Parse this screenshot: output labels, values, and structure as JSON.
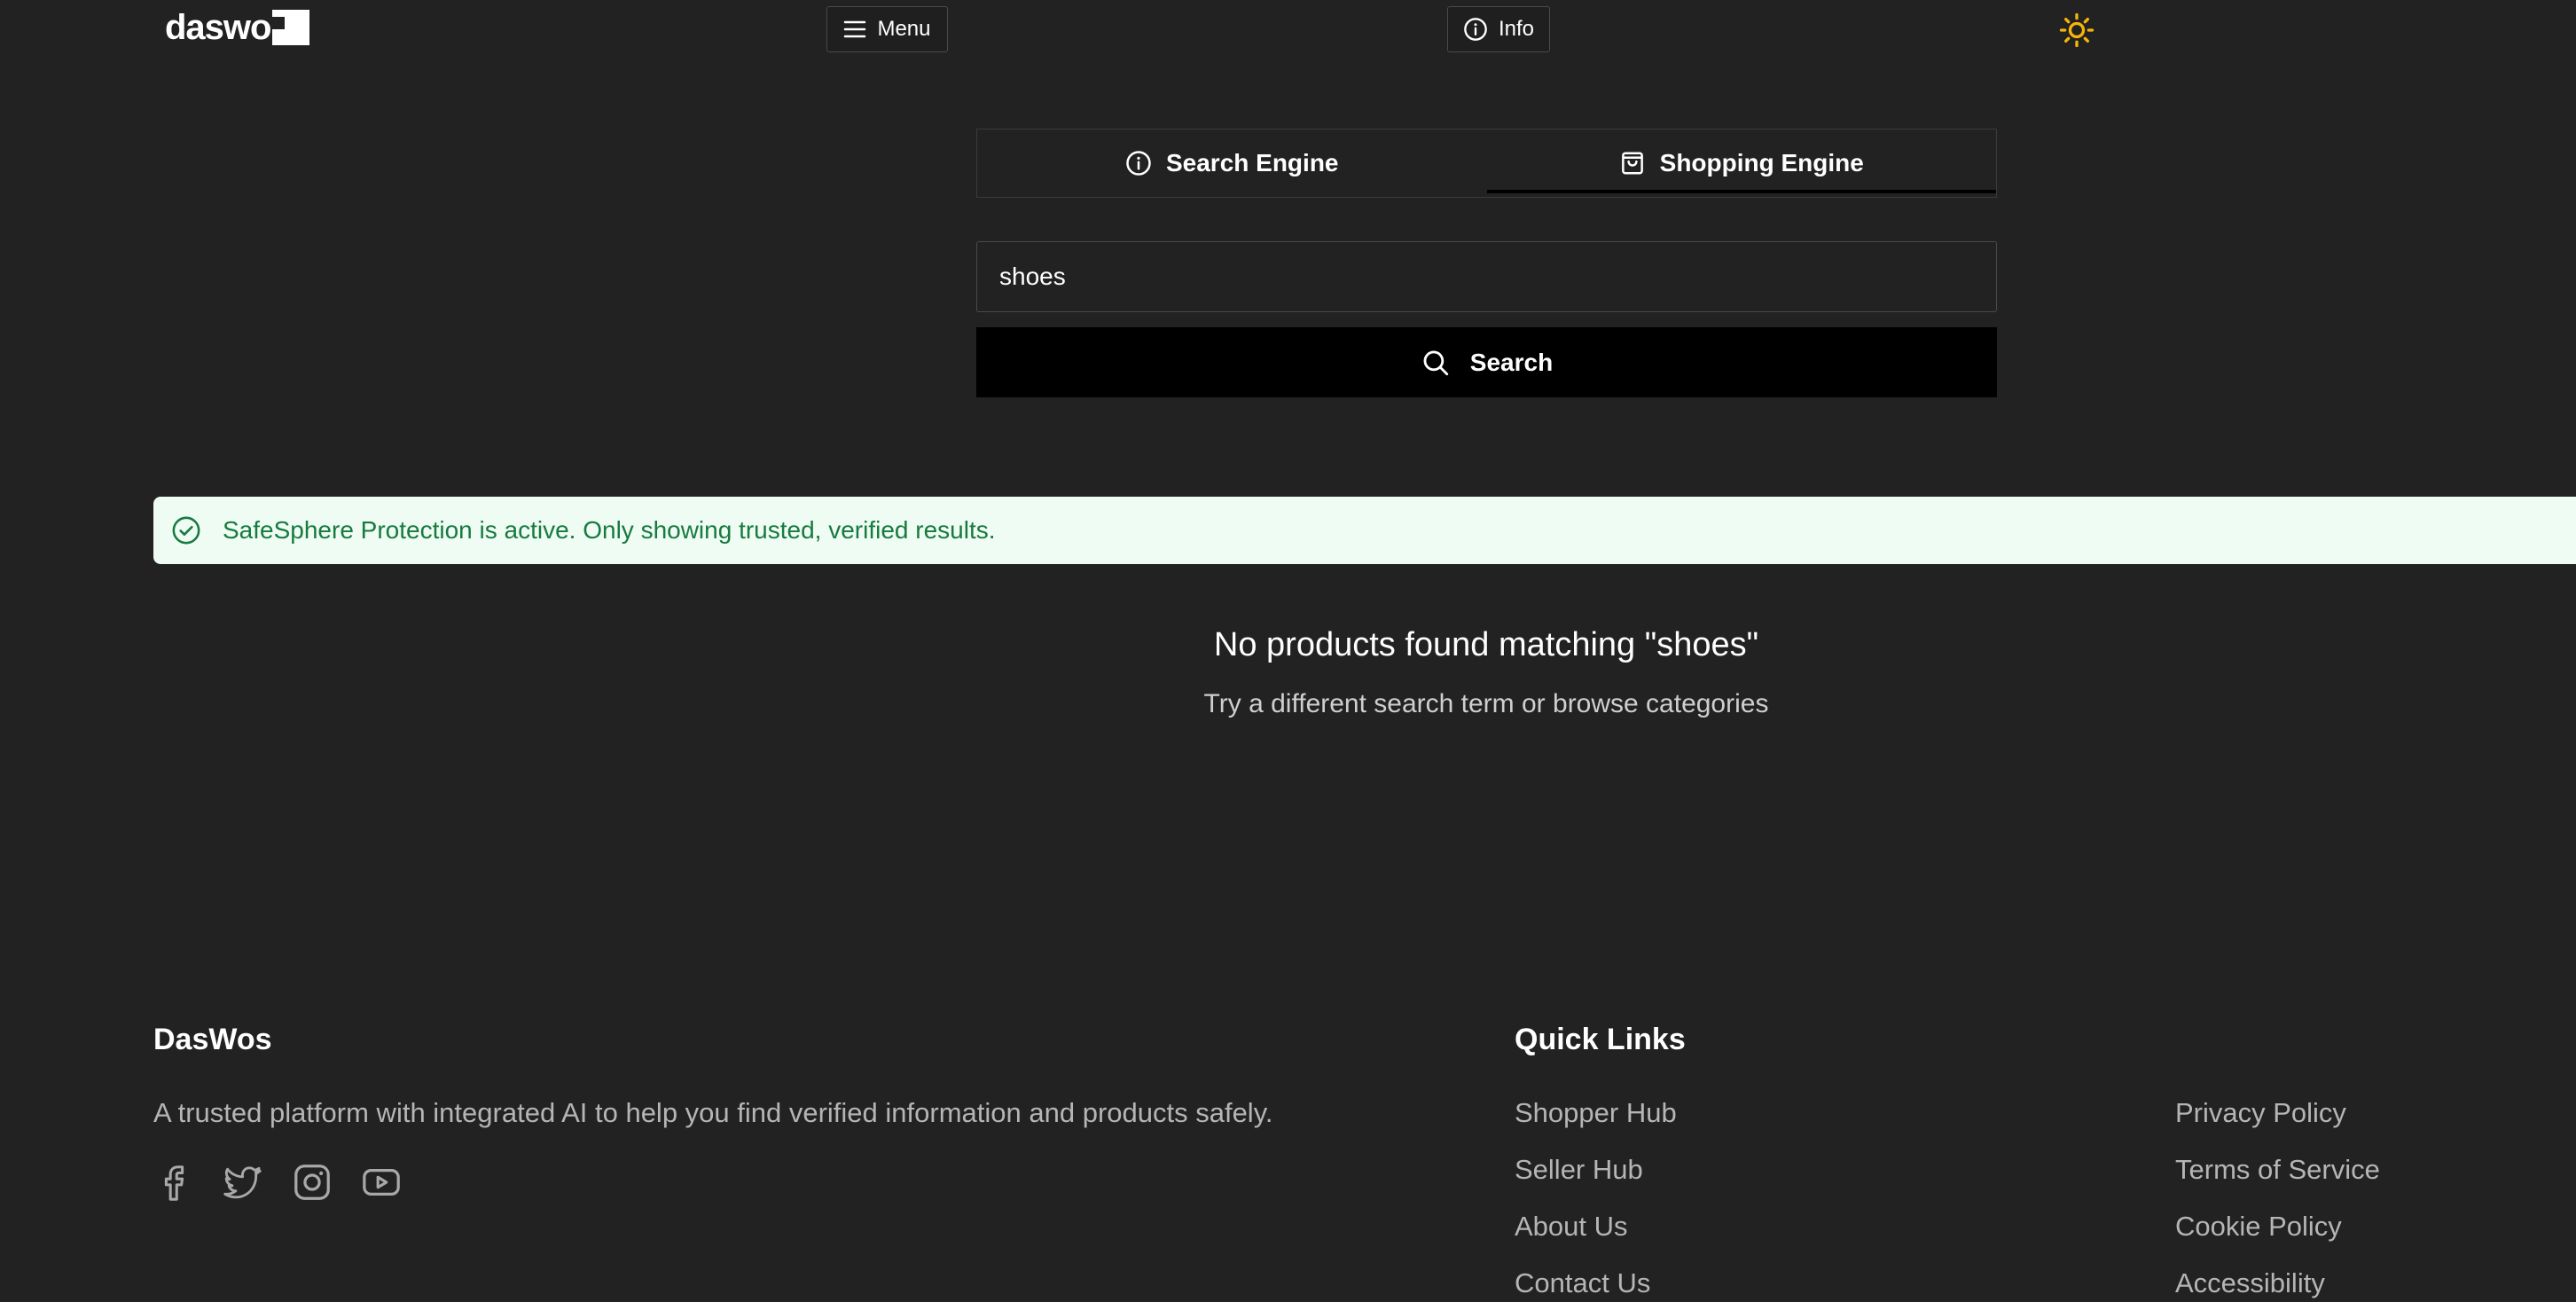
{
  "header": {
    "logo_text": "daswo",
    "menu_label": "Menu",
    "info_label": "Info",
    "theme_icon": "sun-icon"
  },
  "tabs": [
    {
      "label": "Search Engine",
      "icon": "info-circle-icon",
      "active": false
    },
    {
      "label": "Shopping Engine",
      "icon": "shopping-bag-icon",
      "active": true
    }
  ],
  "search": {
    "value": "shoes",
    "button_label": "Search"
  },
  "alert": {
    "text": "SafeSphere Protection is active. Only showing trusted, verified results.",
    "color": "#177a3f",
    "background": "#effcf4"
  },
  "results": {
    "empty_title": "No products found matching \"shoes\"",
    "empty_subtitle": "Try a different search term or browse categories"
  },
  "footer": {
    "brand_title": "DasWos",
    "brand_description": "A trusted platform with integrated AI to help you find verified information and products safely.",
    "social_icons": [
      "facebook-icon",
      "twitter-icon",
      "instagram-icon",
      "youtube-icon"
    ],
    "quick_links_title": "Quick Links",
    "quick_links": [
      "Shopper Hub",
      "Seller Hub",
      "About Us",
      "Contact Us"
    ],
    "legal_links": [
      "Privacy Policy",
      "Terms of Service",
      "Cookie Policy",
      "Accessibility"
    ]
  },
  "colors": {
    "background": "#222222",
    "accent_sun": "#f5b50a"
  }
}
